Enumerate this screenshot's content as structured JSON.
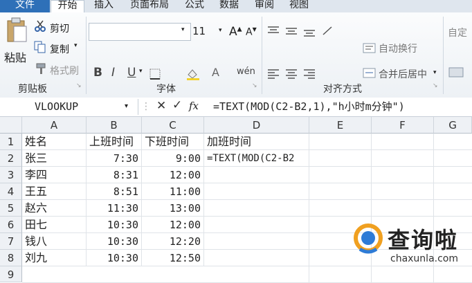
{
  "tabs": [
    "文件",
    "开始",
    "插入",
    "页面布局",
    "公式",
    "数据",
    "审阅",
    "视图"
  ],
  "clipboard": {
    "paste": "粘贴",
    "cut": "剪切",
    "copy": "复制",
    "format_painter": "格式刷",
    "group": "剪贴板"
  },
  "font": {
    "size": "11",
    "bold": "B",
    "italic": "I",
    "underline": "U",
    "wen": "wén",
    "group": "字体"
  },
  "alignment": {
    "wrap": "自动换行",
    "merge": "合并后居中",
    "group": "对齐方式"
  },
  "number": {
    "custom": "自定"
  },
  "formula_bar": {
    "name_box": "VLOOKUP",
    "fx": "fx",
    "formula": "=TEXT(MOD(C2-B2,1),\"h小时m分钟\")"
  },
  "columns": [
    "A",
    "B",
    "C",
    "D",
    "E",
    "F",
    "G"
  ],
  "rows": [
    [
      "1",
      "姓名",
      "上班时间",
      "下班时间",
      "加班时间"
    ],
    [
      "2",
      "张三",
      "7:30",
      "9:00",
      "=TEXT(MOD(C2-B2"
    ],
    [
      "3",
      "李四",
      "8:31",
      "12:00",
      ""
    ],
    [
      "4",
      "王五",
      "8:51",
      "11:00",
      ""
    ],
    [
      "5",
      "赵六",
      "11:30",
      "13:00",
      ""
    ],
    [
      "6",
      "田七",
      "10:30",
      "12:00",
      ""
    ],
    [
      "7",
      "钱八",
      "10:30",
      "12:20",
      ""
    ],
    [
      "8",
      "刘九",
      "10:30",
      "12:50",
      ""
    ],
    [
      "9",
      "",
      "",
      "",
      ""
    ]
  ],
  "watermark": {
    "title": "查询啦",
    "url": "chaxunla.com"
  }
}
